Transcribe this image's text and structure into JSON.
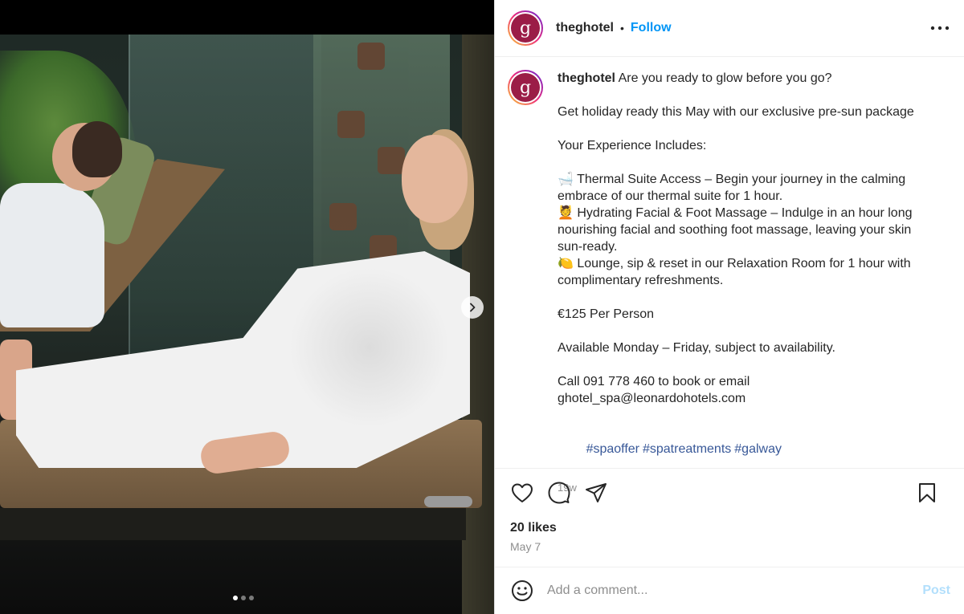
{
  "post": {
    "username": "theghotel",
    "avatar_letter": "g",
    "follow_label": "Follow",
    "separator": "•",
    "caption": {
      "intro": "Are you ready to glow before you go?",
      "line2": "Get holiday ready this May with our exclusive pre-sun package",
      "line3": "Your Experience Includes:",
      "item1": "🛁 Thermal Suite Access – Begin your journey in the calming embrace of our thermal suite for 1 hour.",
      "item2": "💆 Hydrating Facial & Foot Massage – Indulge in an hour long nourishing facial and soothing foot massage, leaving your skin sun-ready.",
      "item3": "🍋 Lounge, sip & reset in our Relaxation Room for 1 hour with complimentary refreshments.",
      "price": "€125 Per Person",
      "availability": "Available Monday – Friday, subject to availability.",
      "contact": "Call 091 778 460 to book or email ghotel_spa@leonardohotels.com",
      "hashtags": [
        "#spaoffer",
        "#spatreatments",
        "#galway"
      ],
      "time_ago": "19w"
    },
    "likes": "20 likes",
    "date": "May 7"
  },
  "media": {
    "carousel_total": 3,
    "carousel_current": 1
  },
  "comment": {
    "placeholder": "Add a comment...",
    "post_label": "Post"
  },
  "icons": {
    "like": "heart-icon",
    "comment": "comment-icon",
    "share": "send-icon",
    "save": "bookmark-icon",
    "emoji": "smiley-icon",
    "more": "more-icon",
    "next": "chevron-right-icon"
  },
  "colors": {
    "link": "#0095f6",
    "hashtag": "#385898",
    "post_disabled": "#b2dffc",
    "avatar_bg": "#9b1d47"
  }
}
